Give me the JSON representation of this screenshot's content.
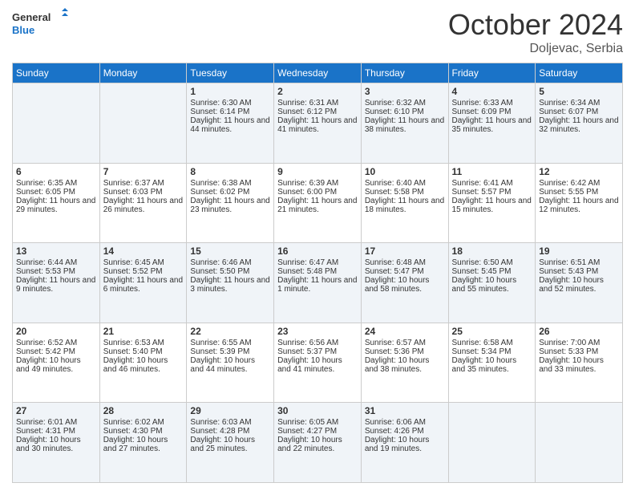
{
  "header": {
    "logo": {
      "line1": "General",
      "line2": "Blue"
    },
    "title": "October 2024",
    "location": "Doljevac, Serbia"
  },
  "weekdays": [
    "Sunday",
    "Monday",
    "Tuesday",
    "Wednesday",
    "Thursday",
    "Friday",
    "Saturday"
  ],
  "weeks": [
    [
      {
        "day": "",
        "sunrise": "",
        "sunset": "",
        "daylight": ""
      },
      {
        "day": "",
        "sunrise": "",
        "sunset": "",
        "daylight": ""
      },
      {
        "day": "1",
        "sunrise": "Sunrise: 6:30 AM",
        "sunset": "Sunset: 6:14 PM",
        "daylight": "Daylight: 11 hours and 44 minutes."
      },
      {
        "day": "2",
        "sunrise": "Sunrise: 6:31 AM",
        "sunset": "Sunset: 6:12 PM",
        "daylight": "Daylight: 11 hours and 41 minutes."
      },
      {
        "day": "3",
        "sunrise": "Sunrise: 6:32 AM",
        "sunset": "Sunset: 6:10 PM",
        "daylight": "Daylight: 11 hours and 38 minutes."
      },
      {
        "day": "4",
        "sunrise": "Sunrise: 6:33 AM",
        "sunset": "Sunset: 6:09 PM",
        "daylight": "Daylight: 11 hours and 35 minutes."
      },
      {
        "day": "5",
        "sunrise": "Sunrise: 6:34 AM",
        "sunset": "Sunset: 6:07 PM",
        "daylight": "Daylight: 11 hours and 32 minutes."
      }
    ],
    [
      {
        "day": "6",
        "sunrise": "Sunrise: 6:35 AM",
        "sunset": "Sunset: 6:05 PM",
        "daylight": "Daylight: 11 hours and 29 minutes."
      },
      {
        "day": "7",
        "sunrise": "Sunrise: 6:37 AM",
        "sunset": "Sunset: 6:03 PM",
        "daylight": "Daylight: 11 hours and 26 minutes."
      },
      {
        "day": "8",
        "sunrise": "Sunrise: 6:38 AM",
        "sunset": "Sunset: 6:02 PM",
        "daylight": "Daylight: 11 hours and 23 minutes."
      },
      {
        "day": "9",
        "sunrise": "Sunrise: 6:39 AM",
        "sunset": "Sunset: 6:00 PM",
        "daylight": "Daylight: 11 hours and 21 minutes."
      },
      {
        "day": "10",
        "sunrise": "Sunrise: 6:40 AM",
        "sunset": "Sunset: 5:58 PM",
        "daylight": "Daylight: 11 hours and 18 minutes."
      },
      {
        "day": "11",
        "sunrise": "Sunrise: 6:41 AM",
        "sunset": "Sunset: 5:57 PM",
        "daylight": "Daylight: 11 hours and 15 minutes."
      },
      {
        "day": "12",
        "sunrise": "Sunrise: 6:42 AM",
        "sunset": "Sunset: 5:55 PM",
        "daylight": "Daylight: 11 hours and 12 minutes."
      }
    ],
    [
      {
        "day": "13",
        "sunrise": "Sunrise: 6:44 AM",
        "sunset": "Sunset: 5:53 PM",
        "daylight": "Daylight: 11 hours and 9 minutes."
      },
      {
        "day": "14",
        "sunrise": "Sunrise: 6:45 AM",
        "sunset": "Sunset: 5:52 PM",
        "daylight": "Daylight: 11 hours and 6 minutes."
      },
      {
        "day": "15",
        "sunrise": "Sunrise: 6:46 AM",
        "sunset": "Sunset: 5:50 PM",
        "daylight": "Daylight: 11 hours and 3 minutes."
      },
      {
        "day": "16",
        "sunrise": "Sunrise: 6:47 AM",
        "sunset": "Sunset: 5:48 PM",
        "daylight": "Daylight: 11 hours and 1 minute."
      },
      {
        "day": "17",
        "sunrise": "Sunrise: 6:48 AM",
        "sunset": "Sunset: 5:47 PM",
        "daylight": "Daylight: 10 hours and 58 minutes."
      },
      {
        "day": "18",
        "sunrise": "Sunrise: 6:50 AM",
        "sunset": "Sunset: 5:45 PM",
        "daylight": "Daylight: 10 hours and 55 minutes."
      },
      {
        "day": "19",
        "sunrise": "Sunrise: 6:51 AM",
        "sunset": "Sunset: 5:43 PM",
        "daylight": "Daylight: 10 hours and 52 minutes."
      }
    ],
    [
      {
        "day": "20",
        "sunrise": "Sunrise: 6:52 AM",
        "sunset": "Sunset: 5:42 PM",
        "daylight": "Daylight: 10 hours and 49 minutes."
      },
      {
        "day": "21",
        "sunrise": "Sunrise: 6:53 AM",
        "sunset": "Sunset: 5:40 PM",
        "daylight": "Daylight: 10 hours and 46 minutes."
      },
      {
        "day": "22",
        "sunrise": "Sunrise: 6:55 AM",
        "sunset": "Sunset: 5:39 PM",
        "daylight": "Daylight: 10 hours and 44 minutes."
      },
      {
        "day": "23",
        "sunrise": "Sunrise: 6:56 AM",
        "sunset": "Sunset: 5:37 PM",
        "daylight": "Daylight: 10 hours and 41 minutes."
      },
      {
        "day": "24",
        "sunrise": "Sunrise: 6:57 AM",
        "sunset": "Sunset: 5:36 PM",
        "daylight": "Daylight: 10 hours and 38 minutes."
      },
      {
        "day": "25",
        "sunrise": "Sunrise: 6:58 AM",
        "sunset": "Sunset: 5:34 PM",
        "daylight": "Daylight: 10 hours and 35 minutes."
      },
      {
        "day": "26",
        "sunrise": "Sunrise: 7:00 AM",
        "sunset": "Sunset: 5:33 PM",
        "daylight": "Daylight: 10 hours and 33 minutes."
      }
    ],
    [
      {
        "day": "27",
        "sunrise": "Sunrise: 6:01 AM",
        "sunset": "Sunset: 4:31 PM",
        "daylight": "Daylight: 10 hours and 30 minutes."
      },
      {
        "day": "28",
        "sunrise": "Sunrise: 6:02 AM",
        "sunset": "Sunset: 4:30 PM",
        "daylight": "Daylight: 10 hours and 27 minutes."
      },
      {
        "day": "29",
        "sunrise": "Sunrise: 6:03 AM",
        "sunset": "Sunset: 4:28 PM",
        "daylight": "Daylight: 10 hours and 25 minutes."
      },
      {
        "day": "30",
        "sunrise": "Sunrise: 6:05 AM",
        "sunset": "Sunset: 4:27 PM",
        "daylight": "Daylight: 10 hours and 22 minutes."
      },
      {
        "day": "31",
        "sunrise": "Sunrise: 6:06 AM",
        "sunset": "Sunset: 4:26 PM",
        "daylight": "Daylight: 10 hours and 19 minutes."
      },
      {
        "day": "",
        "sunrise": "",
        "sunset": "",
        "daylight": ""
      },
      {
        "day": "",
        "sunrise": "",
        "sunset": "",
        "daylight": ""
      }
    ]
  ]
}
